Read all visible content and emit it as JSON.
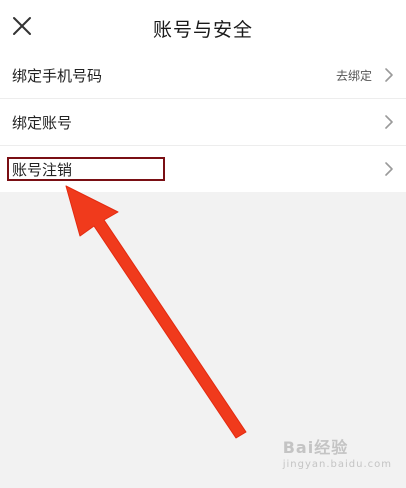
{
  "header": {
    "title": "账号与安全",
    "close_icon": "close-icon"
  },
  "list": {
    "items": [
      {
        "label": "绑定手机号码",
        "value": "去绑定",
        "icon": "chevron-right-icon"
      },
      {
        "label": "绑定账号",
        "value": "",
        "icon": "chevron-right-icon"
      },
      {
        "label": "账号注销",
        "value": "",
        "icon": "chevron-right-icon"
      }
    ]
  },
  "annotation": {
    "highlight_color": "#7a0f14",
    "arrow_color": "#f03a1c"
  },
  "watermark": {
    "text": "Bai经验",
    "sub": "jingyan.baidu.com"
  }
}
